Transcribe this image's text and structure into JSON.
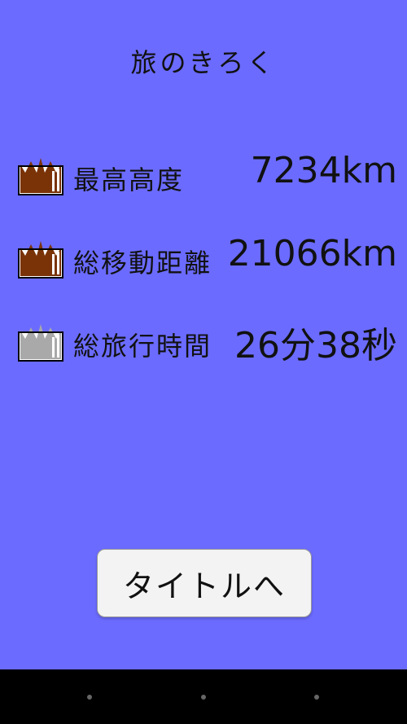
{
  "title": "旅のきろく",
  "records": [
    {
      "label": "最高高度",
      "value": "7234km",
      "crown": "brown-crown-icon",
      "crown_color": "#7a3307"
    },
    {
      "label": "総移動距離",
      "value": "21066km",
      "crown": "brown-crown-icon",
      "crown_color": "#7a3307"
    },
    {
      "label": "総旅行時間",
      "value": "26分38秒",
      "crown": "gray-crown-icon",
      "crown_color": "#a9a9a9"
    }
  ],
  "button": {
    "label": "タイトルへ"
  },
  "colors": {
    "background": "#6b6bff",
    "nav_bar": "#000000"
  }
}
